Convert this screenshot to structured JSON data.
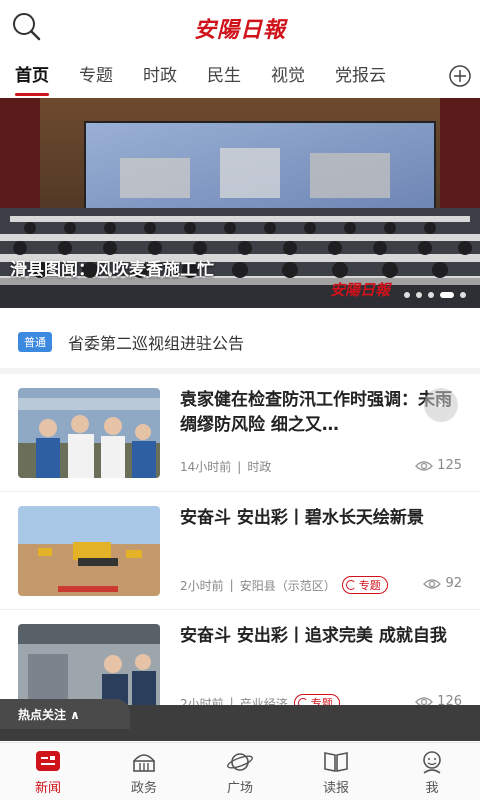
{
  "header": {
    "logo_text": "安陽日報"
  },
  "tabs": [
    {
      "label": "首页",
      "active": true
    },
    {
      "label": "专题"
    },
    {
      "label": "时政"
    },
    {
      "label": "民生"
    },
    {
      "label": "视觉"
    },
    {
      "label": "党报云"
    }
  ],
  "banner": {
    "caption": "滑县图闻：风吹麦香施工忙",
    "watermark": "安陽日報",
    "slide_count": 5,
    "active_slide": 4
  },
  "notice": {
    "badge": "普通",
    "text": "省委第二巡视组进驻公告"
  },
  "news": [
    {
      "title": "袁家健在检查防汛工作时强调：未雨绸缪防风险 细之又…",
      "time": "14小时前",
      "source": "时政",
      "tag": "",
      "views": "125"
    },
    {
      "title": "安奋斗 安出彩丨碧水长天绘新景",
      "time": "2小时前",
      "source": "安阳县（示范区）",
      "tag": "专题",
      "views": "92"
    },
    {
      "title": "安奋斗 安出彩丨追求完美 成就自我",
      "time": "2小时前",
      "source": "产业经济",
      "tag": "专题",
      "views": "126"
    }
  ],
  "hot_bar": {
    "label": "热点关注 ∧"
  },
  "bottom_nav": [
    {
      "label": "新闻",
      "icon": "news-icon",
      "active": true
    },
    {
      "label": "政务",
      "icon": "government-icon"
    },
    {
      "label": "广场",
      "icon": "planet-icon"
    },
    {
      "label": "读报",
      "icon": "newspaper-icon"
    },
    {
      "label": "我",
      "icon": "user-icon"
    }
  ],
  "colors": {
    "brand": "#d0121b",
    "badge": "#3c8ae0"
  }
}
